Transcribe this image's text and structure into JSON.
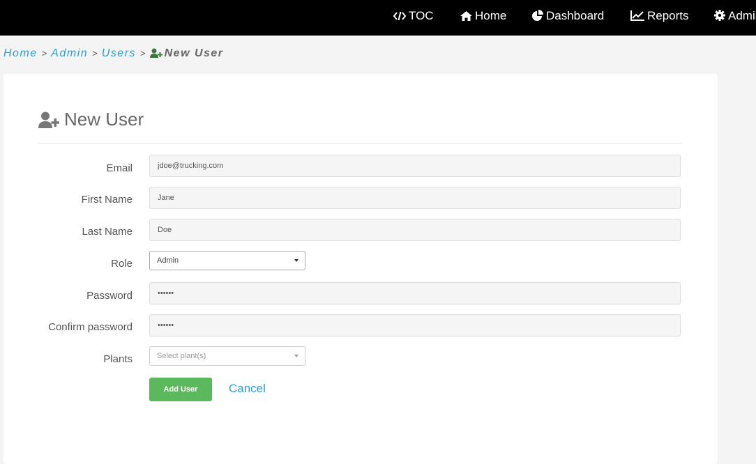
{
  "nav": {
    "toc": "TOC",
    "home": "Home",
    "dashboard": "Dashboard",
    "reports": "Reports",
    "admin": "Admin"
  },
  "breadcrumb": {
    "home": "Home",
    "admin": "Admin",
    "users": "Users",
    "current": "New User",
    "separator": ">"
  },
  "page": {
    "title": "New User"
  },
  "form": {
    "email": {
      "label": "Email",
      "value": "jdoe@trucking.com"
    },
    "first_name": {
      "label": "First Name",
      "value": "Jane"
    },
    "last_name": {
      "label": "Last Name",
      "value": "Doe"
    },
    "role": {
      "label": "Role",
      "selected": "Admin"
    },
    "password": {
      "label": "Password",
      "value": "••••••"
    },
    "confirm_password": {
      "label": "Confirm password",
      "value": "••••••"
    },
    "plants": {
      "label": "Plants",
      "placeholder": "Select plant(s)"
    },
    "submit_label": "Add User",
    "cancel_label": "Cancel"
  },
  "colors": {
    "topbar": "#000000",
    "link": "#2a9fd6",
    "success": "#5cb85c",
    "user_plus_icon_breadcrumb": "#3c763d"
  },
  "icons": {
    "toc": "code-icon",
    "home": "home-icon",
    "dashboard": "pie-chart-icon",
    "reports": "line-chart-icon",
    "admin": "gear-icon",
    "new_user": "user-plus-icon",
    "dropdown": "caret-down-icon"
  }
}
